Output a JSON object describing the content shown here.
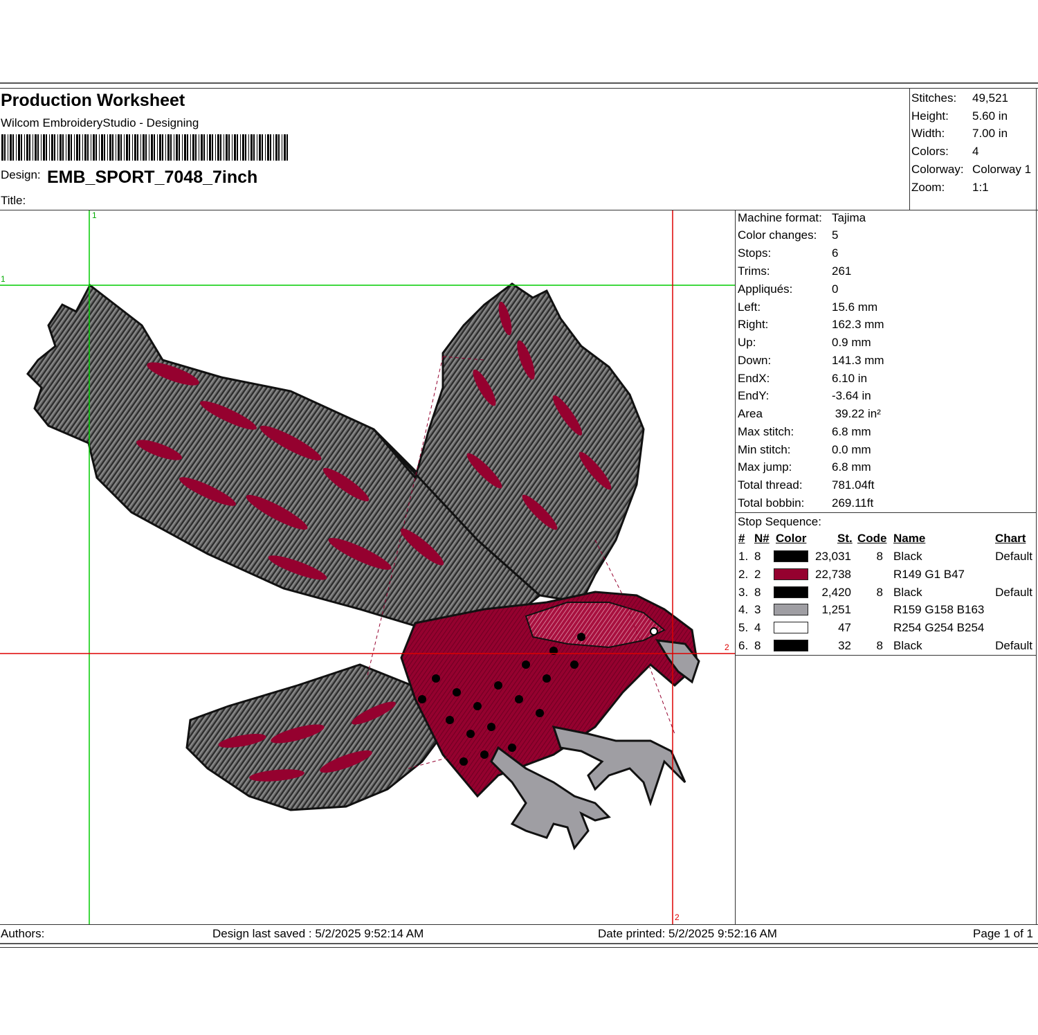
{
  "header": {
    "title": "Production Worksheet",
    "subtitle": "Wilcom EmbroideryStudio - Designing",
    "design_label": "Design:",
    "design_name": "EMB_SPORT_7048_7inch",
    "title_label": "Title:"
  },
  "summary": [
    {
      "label": "Stitches:",
      "value": "49,521"
    },
    {
      "label": "Height:",
      "value": "5.60 in"
    },
    {
      "label": "Width:",
      "value": "7.00 in"
    },
    {
      "label": "Colors:",
      "value": "4"
    },
    {
      "label": "Colorway:",
      "value": "Colorway 1"
    },
    {
      "label": "Zoom:",
      "value": "1:1"
    }
  ],
  "stats": [
    {
      "label": "Machine format:",
      "value": "Tajima"
    },
    {
      "label": "Color changes:",
      "value": "5"
    },
    {
      "label": "Stops:",
      "value": "6"
    },
    {
      "label": "Trims:",
      "value": "261"
    },
    {
      "label": "Appliqués:",
      "value": "0"
    },
    {
      "label": "Left:",
      "value": "15.6 mm"
    },
    {
      "label": "Right:",
      "value": "162.3 mm"
    },
    {
      "label": "Up:",
      "value": "0.9 mm"
    },
    {
      "label": "Down:",
      "value": "141.3 mm"
    },
    {
      "label": "EndX:",
      "value": "6.10 in"
    },
    {
      "label": "EndY:",
      "value": "-3.64 in"
    },
    {
      "label": "Area",
      "value": " 39.22 in²"
    },
    {
      "label": "Max stitch:",
      "value": "6.8 mm"
    },
    {
      "label": "Min stitch:",
      "value": "0.0 mm"
    },
    {
      "label": "Max jump:",
      "value": "6.8 mm"
    },
    {
      "label": "Total thread:",
      "value": "781.04ft"
    },
    {
      "label": "Total bobbin:",
      "value": "269.11ft"
    }
  ],
  "stop_sequence": {
    "title": "Stop Sequence:",
    "headers": {
      "num": "#",
      "needle": "N#",
      "color": "Color",
      "stitches": "St.",
      "code": "Code",
      "name": "Name",
      "chart": "Chart"
    },
    "rows": [
      {
        "num": "1.",
        "needle": "8",
        "color": "#000000",
        "stitches": "23,031",
        "code": "8",
        "name": "Black",
        "chart": "Default"
      },
      {
        "num": "2.",
        "needle": "2",
        "color": "#95012F",
        "stitches": "22,738",
        "code": "",
        "name": "R149 G1 B47",
        "chart": ""
      },
      {
        "num": "3.",
        "needle": "8",
        "color": "#000000",
        "stitches": "2,420",
        "code": "8",
        "name": "Black",
        "chart": "Default"
      },
      {
        "num": "4.",
        "needle": "3",
        "color": "#9F9EA3",
        "stitches": "1,251",
        "code": "",
        "name": "R159 G158 B163",
        "chart": ""
      },
      {
        "num": "5.",
        "needle": "4",
        "color": "#FEFEFE",
        "stitches": "47",
        "code": "",
        "name": "R254 G254 B254",
        "chart": ""
      },
      {
        "num": "6.",
        "needle": "8",
        "color": "#000000",
        "stitches": "32",
        "code": "8",
        "name": "Black",
        "chart": "Default"
      }
    ]
  },
  "canvas": {
    "guide_labels": {
      "green_top": "1",
      "green_left": "1",
      "red_right": "2",
      "red_bottom": "2"
    }
  },
  "footer": {
    "authors": "Authors:",
    "last_saved": "Design last saved : 5/2/2025 9:52:14 AM",
    "printed": "Date printed: 5/2/2025 9:52:16 AM",
    "page": "Page 1 of 1"
  },
  "colors": {
    "black": "#000000",
    "burgundy": "#95012F",
    "gray": "#9F9EA3",
    "white": "#FEFEFE",
    "guide_green": "#00cc00",
    "guide_red": "#dd0000"
  }
}
